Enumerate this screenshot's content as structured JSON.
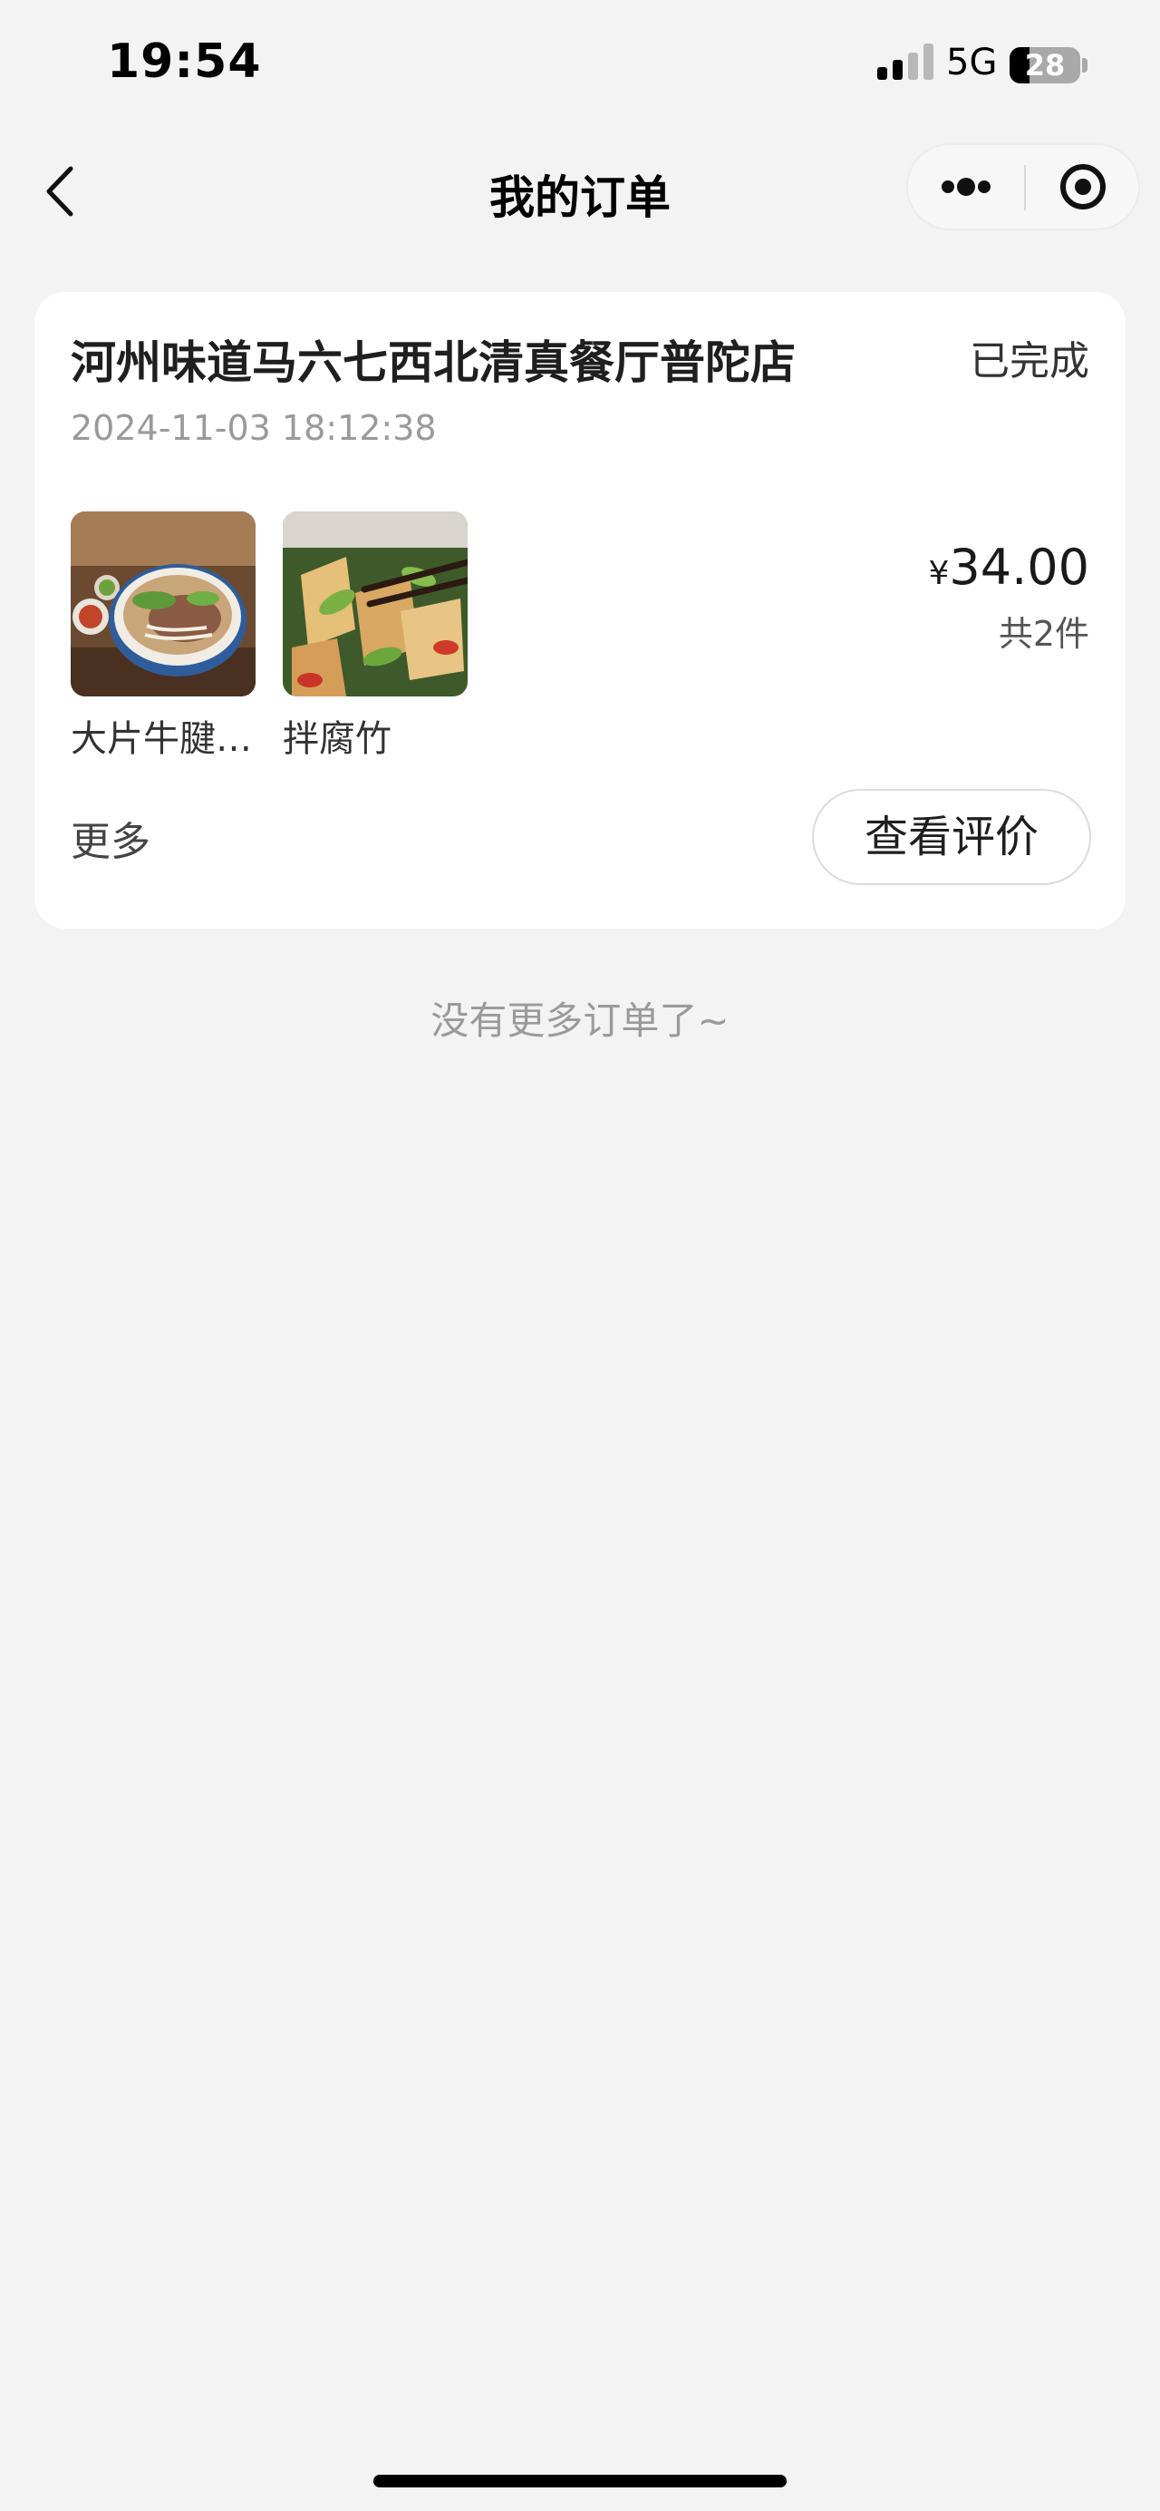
{
  "status_bar": {
    "time": "19:54",
    "network": "5G",
    "battery_percent": "28",
    "battery_level": 0.28,
    "signal_bars_active": 2,
    "signal_bars_total": 4
  },
  "nav": {
    "title": "我的订单",
    "back_icon": "chevron-left-icon",
    "more_icon": "more-dots-icon",
    "close_icon": "target-circle-icon"
  },
  "order": {
    "store_name": "河州味道马六七西北清真餐厅普陀店",
    "status": "已完成",
    "time": "2024-11-03 18:12:38",
    "items": [
      {
        "name": "大片牛腱子面"
      },
      {
        "name": "拌腐竹"
      }
    ],
    "currency": "¥",
    "amount": "34.00",
    "quantity_text": "共2件",
    "more_label": "更多",
    "review_button_label": "查看评价"
  },
  "footer_note": "没有更多订单了~"
}
